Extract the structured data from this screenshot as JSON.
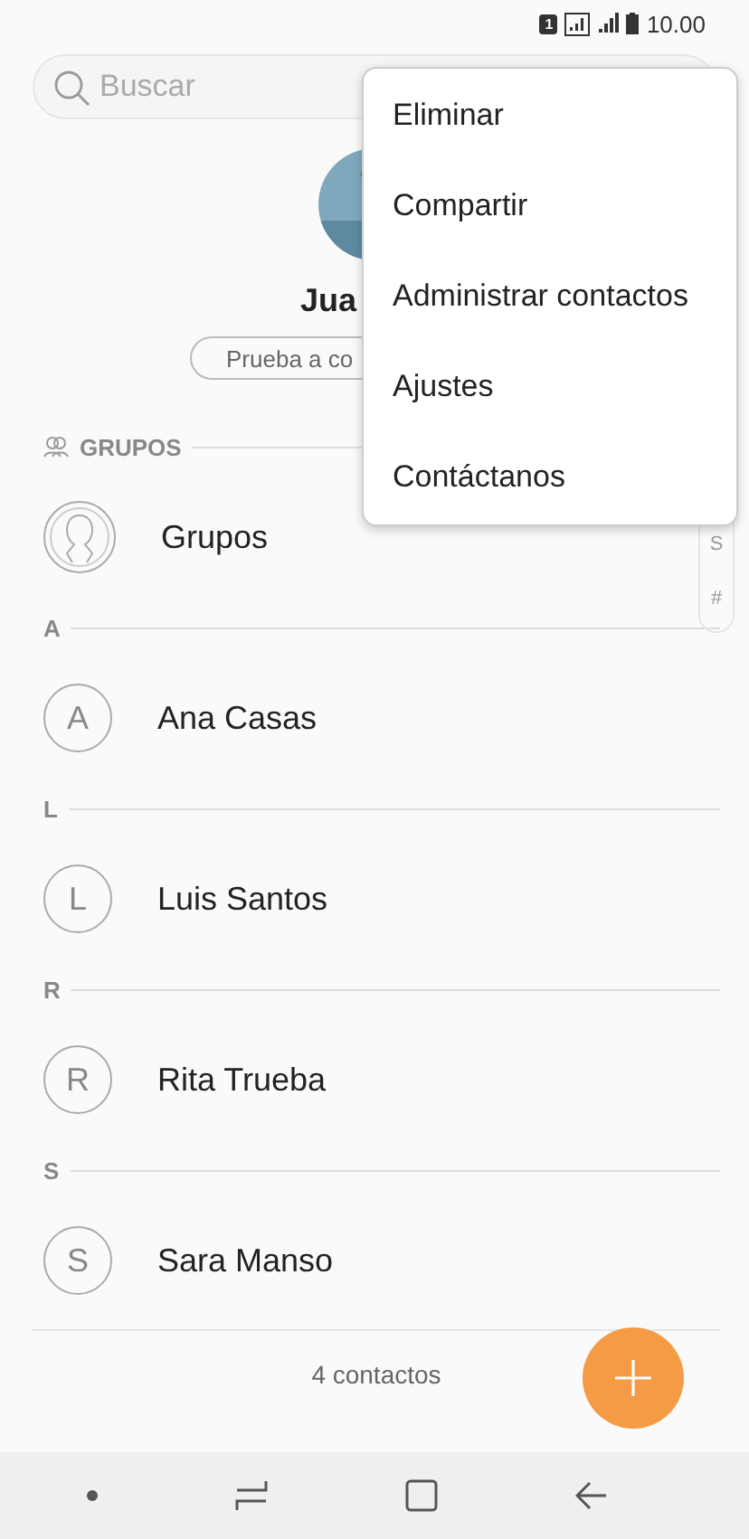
{
  "status_bar": {
    "sim": "1",
    "time": "10.00"
  },
  "search": {
    "placeholder": "Buscar"
  },
  "profile": {
    "name": "Jua",
    "button": "Prueba a co"
  },
  "groups_header": "GRUPOS",
  "groups_item": "Grupos",
  "sections": [
    {
      "letter": "A",
      "contacts": [
        {
          "initial": "A",
          "name": "Ana Casas"
        }
      ]
    },
    {
      "letter": "L",
      "contacts": [
        {
          "initial": "L",
          "name": "Luis Santos"
        }
      ]
    },
    {
      "letter": "R",
      "contacts": [
        {
          "initial": "R",
          "name": "Rita Trueba"
        }
      ]
    },
    {
      "letter": "S",
      "contacts": [
        {
          "initial": "S",
          "name": "Sara Manso"
        }
      ]
    }
  ],
  "index_bar": [
    "S",
    "#"
  ],
  "footer": "4 contactos",
  "menu": [
    "Eliminar",
    "Compartir",
    "Administrar contactos",
    "Ajustes",
    "Contáctanos"
  ]
}
